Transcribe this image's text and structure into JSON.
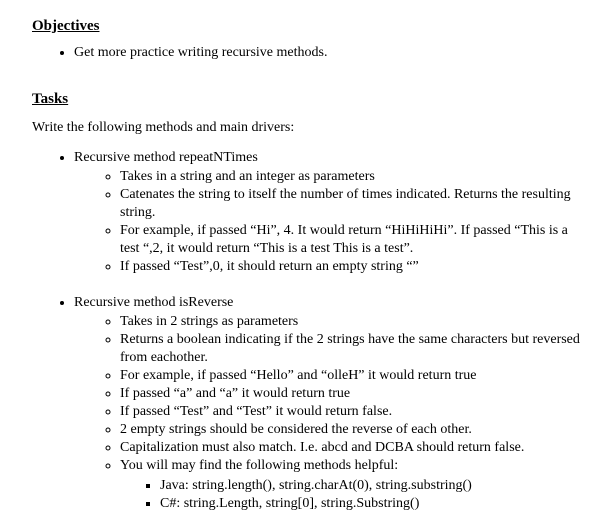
{
  "headings": {
    "objectives": "Objectives",
    "tasks": "Tasks"
  },
  "objectives_items": [
    "Get more practice writing recursive methods."
  ],
  "tasks_intro": "Write the following methods and main drivers:",
  "methods": [
    {
      "title": "Recursive method repeatNTimes",
      "points": [
        "Takes in a string and an integer as parameters",
        "Catenates the string to itself the number of times indicated.  Returns the resulting string.",
        "For example, if passed “Hi”, 4.  It would return “HiHiHiHi”.  If passed “This is a test “,2, it would return “This is a test This is a test”.",
        "If passed “Test”,0, it should return an empty string “”"
      ],
      "sub": []
    },
    {
      "title": "Recursive method isReverse",
      "points": [
        "Takes in 2 strings as parameters",
        "Returns a boolean indicating if the 2 strings have the same characters but reversed from eachother.",
        "For example, if passed “Hello” and “olleH” it would return true",
        "If passed “a” and “a” it would return true",
        "If passed “Test” and “Test” it would return false.",
        "2 empty strings should be considered the reverse of each other.",
        "Capitalization must also match.  I.e.  abcd and DCBA should return false.",
        "You will may find the following methods helpful:"
      ],
      "sub": [
        "Java:  string.length(), string.charAt(0), string.substring()",
        "C#:  string.Length, string[0], string.Substring()"
      ]
    }
  ]
}
